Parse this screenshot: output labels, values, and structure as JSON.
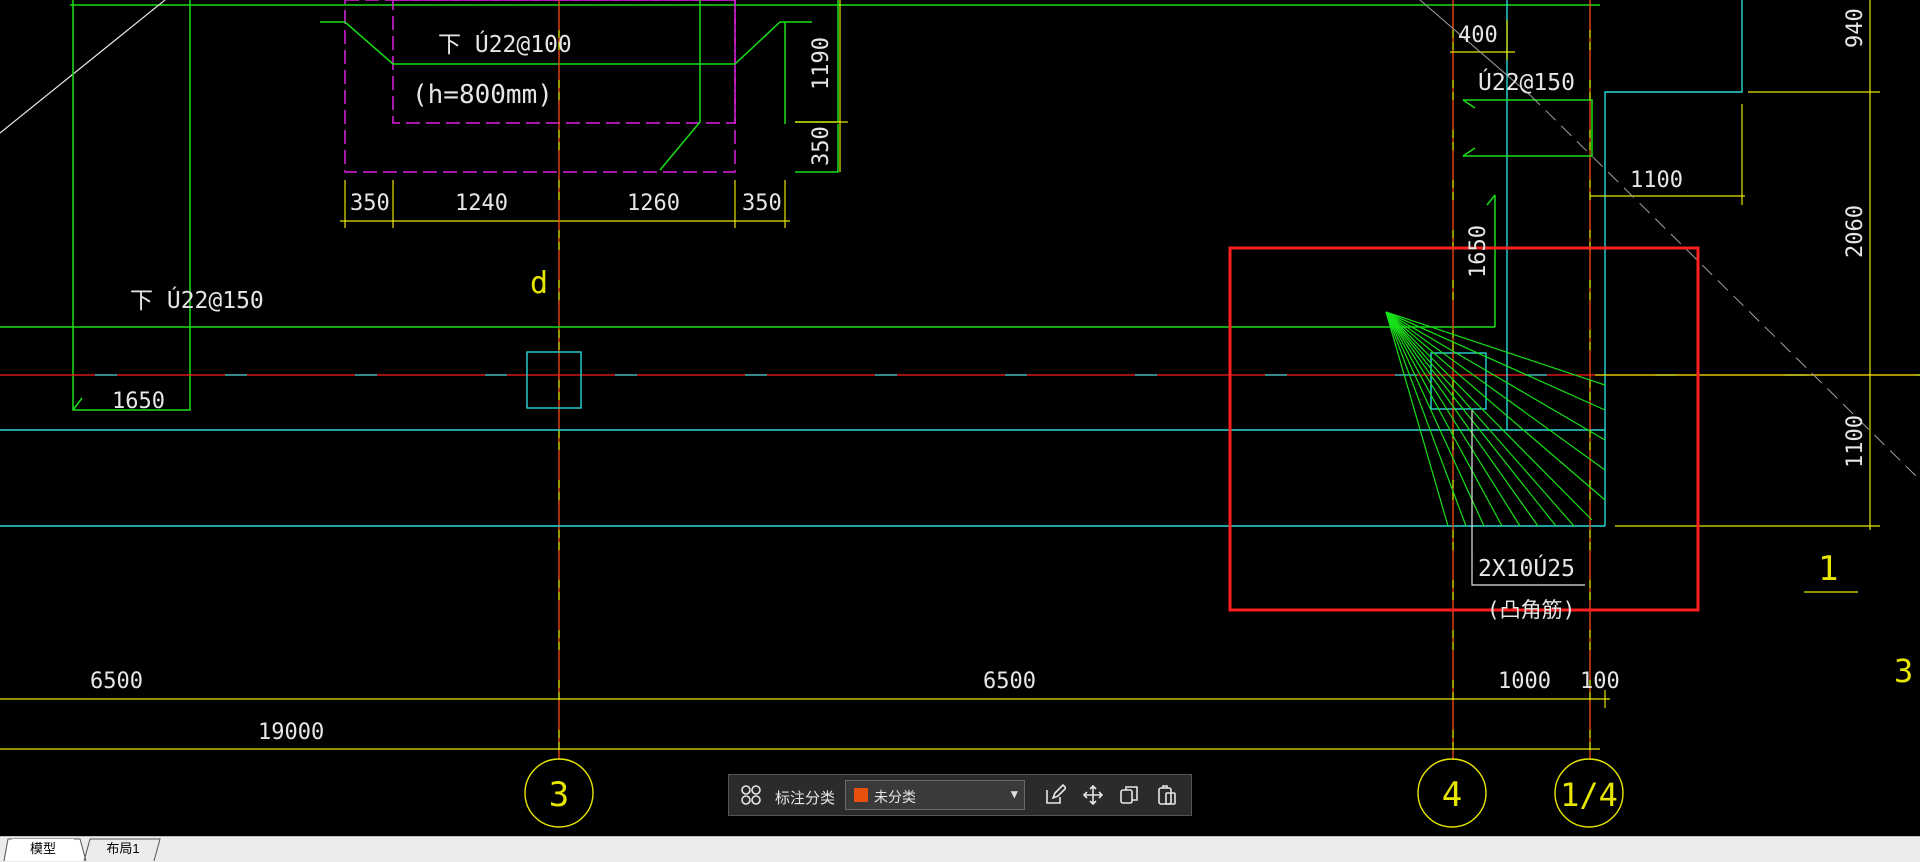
{
  "colors": {
    "green": "#18e018",
    "yellow": "#e6e600",
    "cyan": "#28d8d8",
    "red": "#ff1a1a",
    "magenta": "#e020e0",
    "white": "#e6e6e6",
    "highlight": "#ff2020",
    "swatch": "#e8500e"
  },
  "labels": {
    "rebar_top": "下 Ú22@100",
    "height_note": "(h=800mm)",
    "rebar_left": "下 Ú22@150",
    "rebar_right": "Ú22@150",
    "axis_d": "d",
    "bundle": "2X10Ú25",
    "bundle_note": "(凸角筋)",
    "section_1": "1",
    "section_3": "3"
  },
  "dimensions": {
    "d350_a": "350",
    "d1240": "1240",
    "d1260": "1260",
    "d350_b": "350",
    "v1190": "1190",
    "v350": "350",
    "d400": "400",
    "d1100_top": "1100",
    "v1650": "1650",
    "d1650_left": "1650",
    "v940": "940",
    "v2060": "2060",
    "v1100": "1100",
    "d6500_a": "6500",
    "d6500_b": "6500",
    "d1000": "1000",
    "d100": "100",
    "d19000": "19000"
  },
  "axes": {
    "a3": "3",
    "a4": "4",
    "a14": "1/4"
  },
  "toolbar": {
    "group_icon": "group-icon",
    "label": "标注分类",
    "selected": "未分类",
    "edit_icon": "edit-icon",
    "move_icon": "move-icon",
    "copy_icon": "copy-icon",
    "paste_icon": "paste-icon"
  },
  "tabs": [
    {
      "label": "模型",
      "active": true
    },
    {
      "label": "布局1",
      "active": false
    }
  ]
}
